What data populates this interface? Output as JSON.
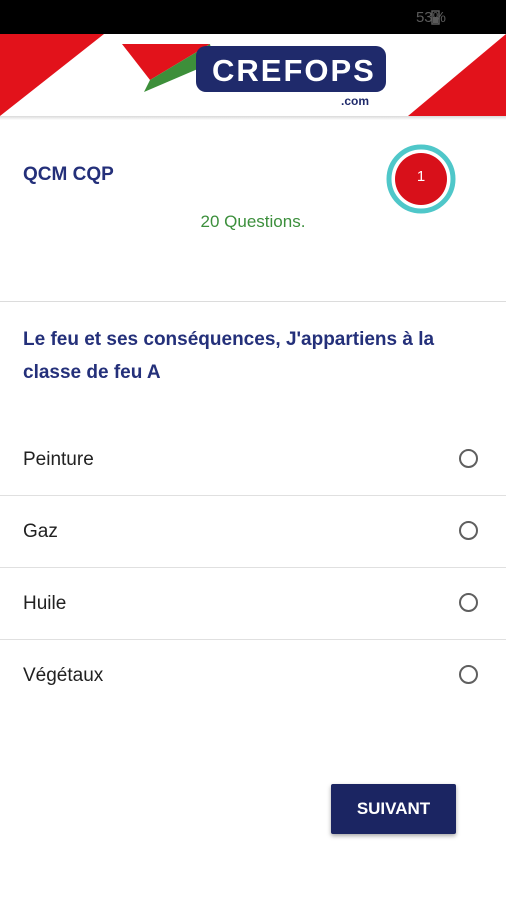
{
  "status_bar": {
    "battery": "53%",
    "battery_icon": "battery-icon"
  },
  "header": {
    "logo_text": "CREFOPS",
    "logo_sub": ".com",
    "colors": {
      "red": "#e2121b",
      "green": "#3d8f3a",
      "navy": "#1f2a6b"
    }
  },
  "quiz": {
    "title": "QCM CQP",
    "question_count": "20 Questions.",
    "timer_value": "1",
    "timer_colors": {
      "fill": "#d8101a",
      "ring": "#4fc7c9"
    }
  },
  "question": {
    "text": "Le feu et ses conséquences, J'appartiens à la classe de feu A"
  },
  "answers": [
    {
      "label": "Peinture"
    },
    {
      "label": "Gaz"
    },
    {
      "label": "Huile"
    },
    {
      "label": "Végétaux"
    }
  ],
  "actions": {
    "next_label": "SUIVANT"
  }
}
